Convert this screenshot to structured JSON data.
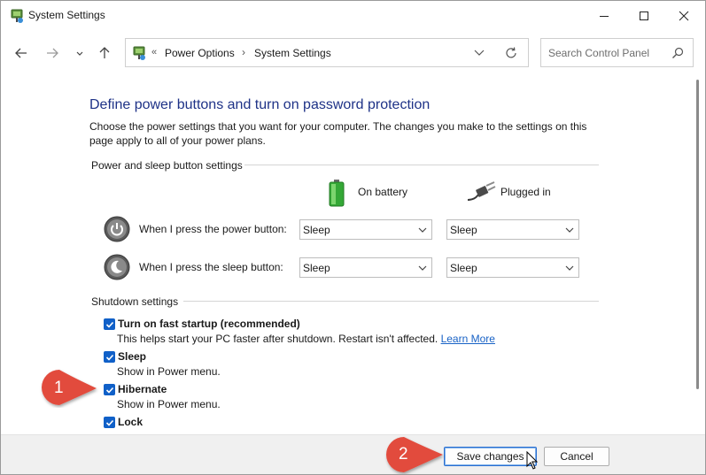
{
  "window": {
    "title": "System Settings",
    "controls": {
      "minimize": "minimize",
      "maximize": "maximize",
      "close": "close"
    }
  },
  "nav": {
    "breadcrumb_prefix": "«",
    "breadcrumbs": [
      "Power Options",
      "System Settings"
    ],
    "breadcrumb_separator": "›",
    "search_placeholder": "Search Control Panel"
  },
  "page": {
    "heading": "Define power buttons and turn on password protection",
    "description": "Choose the power settings that you want for your computer. The changes you make to the settings on this page apply to all of your power plans."
  },
  "power_section": {
    "label": "Power and sleep button settings",
    "columns": {
      "battery": "On battery",
      "plugged": "Plugged in"
    },
    "rows": [
      {
        "label": "When I press the power button:",
        "battery": "Sleep",
        "plugged": "Sleep",
        "icon": "power-button-icon"
      },
      {
        "label": "When I press the sleep button:",
        "battery": "Sleep",
        "plugged": "Sleep",
        "icon": "sleep-button-icon"
      }
    ]
  },
  "shutdown_section": {
    "label": "Shutdown settings",
    "items": [
      {
        "label": "Turn on fast startup (recommended)",
        "sub": "This helps start your PC faster after shutdown. Restart isn't affected.",
        "link": "Learn More",
        "checked": true
      },
      {
        "label": "Sleep",
        "sub": "Show in Power menu.",
        "checked": true
      },
      {
        "label": "Hibernate",
        "sub": "Show in Power menu.",
        "checked": true
      },
      {
        "label": "Lock",
        "checked": true
      }
    ]
  },
  "footer": {
    "save_label": "Save changes",
    "cancel_label": "Cancel"
  },
  "callouts": [
    "1",
    "2"
  ],
  "colors": {
    "heading": "#1e3287",
    "link": "#1862c6",
    "checkbox": "#1060c8",
    "callout": "#e24b3d",
    "footer_bg": "#f0f0f0"
  }
}
